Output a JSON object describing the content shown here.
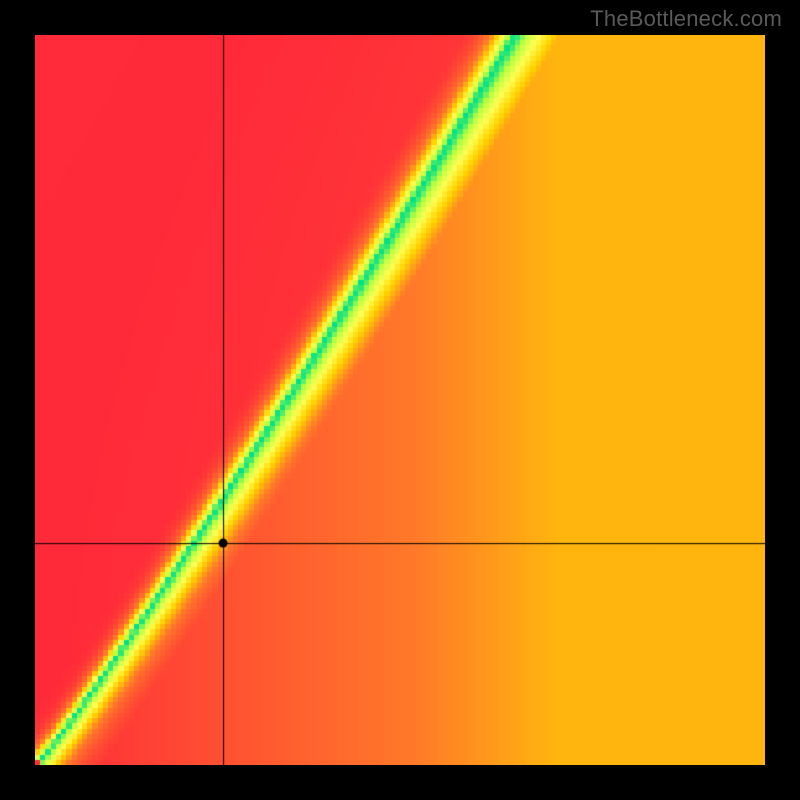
{
  "watermark": "TheBottleneck.com",
  "chart_data": {
    "type": "heatmap",
    "title": "",
    "xlabel": "",
    "ylabel": "",
    "xlim": [
      0,
      1
    ],
    "ylim": [
      0,
      1
    ],
    "grid": false,
    "legend": false,
    "crosshair": {
      "x": 0.258,
      "y": 0.303
    },
    "marker": {
      "x": 0.258,
      "y": 0.303
    },
    "optimal_band": {
      "description": "Green band where y ≈ f(x); slope >1, slight S-curve",
      "slope_approx": 1.55
    },
    "color_scale": {
      "0.00": "#ff2a3a",
      "0.35": "#ff7a2a",
      "0.55": "#ffd400",
      "0.72": "#ffff55",
      "0.88": "#b8ff40",
      "1.00": "#00e08a"
    },
    "series": [
      {
        "name": "optimal-center",
        "x": [
          0.0,
          0.1,
          0.2,
          0.3,
          0.4,
          0.5,
          0.6,
          0.65
        ],
        "values": [
          0.0,
          0.13,
          0.28,
          0.45,
          0.62,
          0.78,
          0.93,
          1.0
        ]
      },
      {
        "name": "band-lower",
        "x": [
          0.0,
          0.1,
          0.2,
          0.3,
          0.4,
          0.5,
          0.6,
          0.7
        ],
        "values": [
          0.0,
          0.1,
          0.23,
          0.38,
          0.54,
          0.69,
          0.83,
          0.95
        ]
      },
      {
        "name": "band-upper",
        "x": [
          0.0,
          0.1,
          0.2,
          0.3,
          0.4,
          0.5,
          0.57
        ],
        "values": [
          0.0,
          0.17,
          0.34,
          0.52,
          0.7,
          0.87,
          1.0
        ]
      }
    ]
  }
}
